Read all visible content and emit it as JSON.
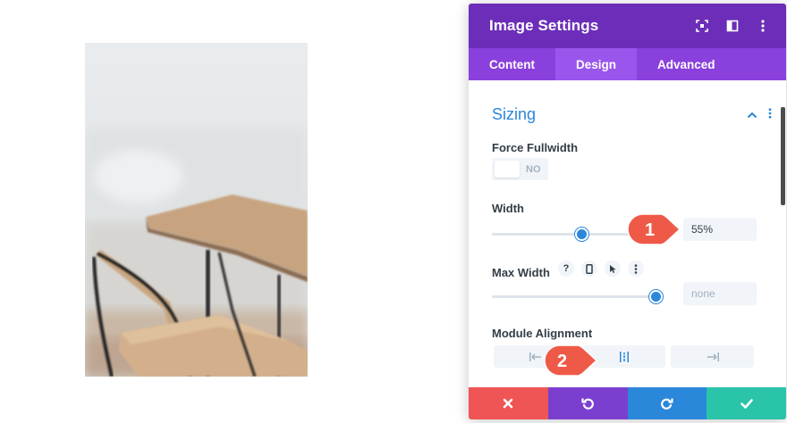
{
  "panel": {
    "title": "Image Settings",
    "header_icons": [
      "expand-icon",
      "split-view-icon",
      "more-vertical-icon"
    ],
    "tabs": [
      {
        "label": "Content",
        "active": false
      },
      {
        "label": "Design",
        "active": true
      },
      {
        "label": "Advanced",
        "active": false
      }
    ],
    "colors": {
      "header": "#6c2eb9",
      "tabs": "#8a40dd",
      "accent": "#2b87da"
    }
  },
  "sizing": {
    "section_title": "Sizing",
    "force_fullwidth": {
      "label": "Force Fullwidth",
      "toggle_text": "NO",
      "value": false
    },
    "width": {
      "label": "Width",
      "value": "55%",
      "slider_fraction": 0.55
    },
    "max_width": {
      "label": "Max Width",
      "value": "",
      "placeholder": "none",
      "slider_fraction": 1.0,
      "icons": [
        "help-icon",
        "mobile-icon",
        "cursor-icon",
        "more-vertical-icon"
      ],
      "help_glyph": "?"
    },
    "module_alignment": {
      "label": "Module Alignment",
      "options": [
        "align-left-icon",
        "align-center-icon",
        "align-right-icon"
      ],
      "selected": "center"
    }
  },
  "footer": {
    "buttons": [
      {
        "name": "cancel",
        "color": "#ef5555"
      },
      {
        "name": "undo",
        "color": "#7b3fd0"
      },
      {
        "name": "redo",
        "color": "#2b87da"
      },
      {
        "name": "save",
        "color": "#29c4a9"
      }
    ]
  },
  "callouts": [
    {
      "number": "1",
      "color": "#ef5a48"
    },
    {
      "number": "2",
      "color": "#ef5a48"
    }
  ]
}
